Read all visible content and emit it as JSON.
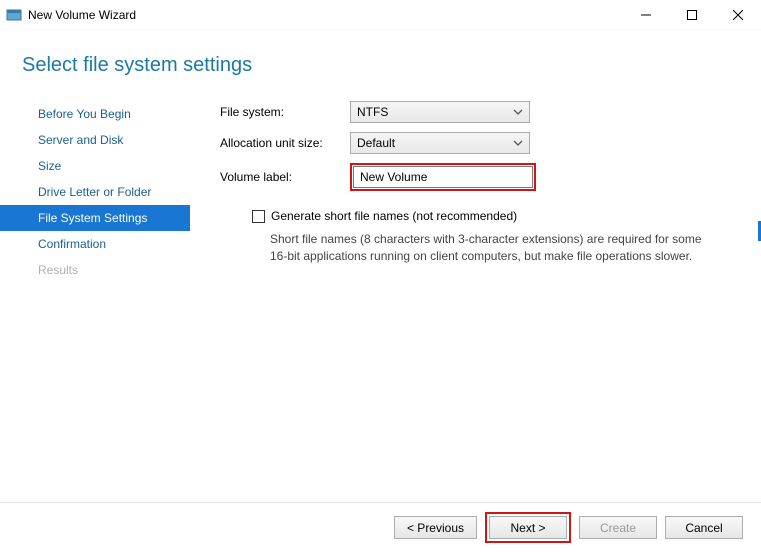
{
  "window": {
    "title": "New Volume Wizard"
  },
  "heading": "Select file system settings",
  "sidebar": {
    "items": [
      {
        "label": "Before You Begin",
        "state": "normal"
      },
      {
        "label": "Server and Disk",
        "state": "normal"
      },
      {
        "label": "Size",
        "state": "normal"
      },
      {
        "label": "Drive Letter or Folder",
        "state": "normal"
      },
      {
        "label": "File System Settings",
        "state": "selected"
      },
      {
        "label": "Confirmation",
        "state": "normal"
      },
      {
        "label": "Results",
        "state": "disabled"
      }
    ]
  },
  "form": {
    "file_system_label": "File system:",
    "file_system_value": "NTFS",
    "alloc_label": "Allocation unit size:",
    "alloc_value": "Default",
    "volume_label_label": "Volume label:",
    "volume_label_value": "New Volume",
    "checkbox_label": "Generate short file names (not recommended)",
    "help_text": "Short file names (8 characters with 3-character extensions) are required for some 16-bit applications running on client computers, but make file operations slower."
  },
  "buttons": {
    "previous": "< Previous",
    "next": "Next >",
    "create": "Create",
    "cancel": "Cancel"
  }
}
